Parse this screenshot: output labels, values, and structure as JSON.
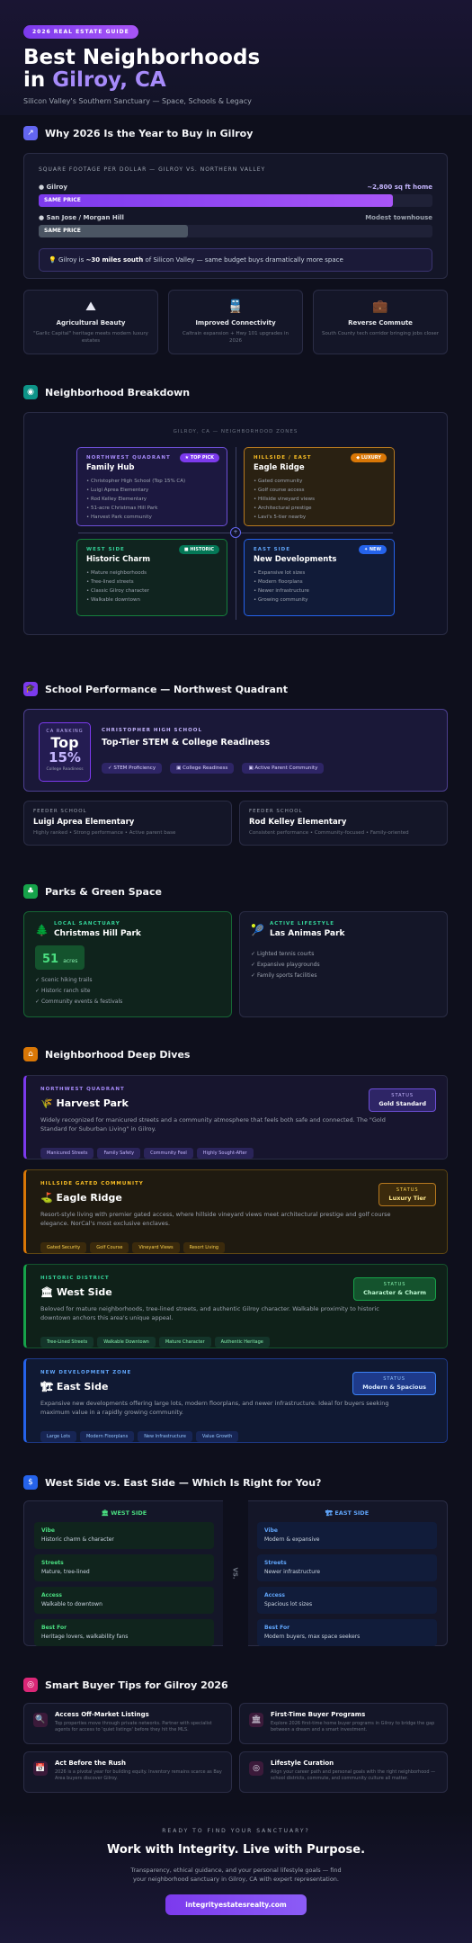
{
  "hero": {
    "badge": "2026 REAL ESTATE GUIDE",
    "title_line1": "Best Neighborhoods",
    "title_in": "in ",
    "title_accent": "Gilroy, CA",
    "subtitle": "Silicon Valley's Southern Sanctuary — Space, Schools & Legacy"
  },
  "why": {
    "title": "Why 2026 Is the Year to Buy in Gilroy",
    "chart_label": "SQUARE FOOTAGE PER DOLLAR — GILROY VS. NORTHERN VALLEY",
    "rows": [
      {
        "name": "Gilroy",
        "value": "~2,800 sq ft home",
        "bar_text": "SAME PRICE",
        "fill": 0.9
      },
      {
        "name": "San Jose / Morgan Hill",
        "value": "Modest townhouse",
        "bar_text": "SAME PRICE",
        "fill": 0.38
      }
    ],
    "callout_pre": "Gilroy is ",
    "callout_bold": "~30 miles south",
    "callout_post": " of Silicon Valley — same budget buys dramatically more space",
    "cards": [
      {
        "icon": "mountain-icon",
        "title": "Agricultural Beauty",
        "desc": "\"Garlic Capital\" heritage meets modern luxury estates"
      },
      {
        "icon": "train-icon",
        "title": "Improved Connectivity",
        "desc": "Caltrain expansion + Hwy 101 upgrades in 2026"
      },
      {
        "icon": "briefcase-icon",
        "title": "Reverse Commute",
        "desc": "South County tech corridor bringing jobs closer"
      }
    ]
  },
  "breakdown": {
    "title": "Neighborhood Breakdown",
    "map_label": "GILROY, CA — NEIGHBORHOOD ZONES",
    "quads": [
      {
        "tag": "NORTHWEST QUADRANT",
        "badge": "TOP PICK",
        "title": "Family Hub",
        "items": [
          "Christopher High School (Top 15% CA)",
          "Luigi Aprea Elementary",
          "Rod Kelley Elementary",
          "51-acre Christmas Hill Park",
          "Harvest Park community"
        ]
      },
      {
        "tag": "HILLSIDE / EAST",
        "badge": "LUXURY",
        "title": "Eagle Ridge",
        "items": [
          "Gated community",
          "Golf course access",
          "Hillside vineyard views",
          "Architectural prestige",
          "Lavi's 5-tier nearby"
        ]
      },
      {
        "tag": "WEST SIDE",
        "badge": "HISTORIC",
        "title": "Historic Charm",
        "items": [
          "Mature neighborhoods",
          "Tree-lined streets",
          "Classic Gilroy character",
          "Walkable downtown"
        ]
      },
      {
        "tag": "EAST SIDE",
        "badge": "NEW",
        "title": "New Developments",
        "items": [
          "Expansive lot sizes",
          "Modern floorplans",
          "Newer infrastructure",
          "Growing community"
        ]
      }
    ]
  },
  "school": {
    "title": "School Performance — Northwest Quadrant",
    "rank_label": "CA RANKING",
    "rank_top": "Top",
    "rank_pct": "15%",
    "rank_sub": "College Readiness",
    "school_name": "CHRISTOPHER HIGH SCHOOL",
    "headline": "Top-Tier STEM & College Readiness",
    "chips": [
      "STEM Proficiency",
      "College Readiness",
      "Active Parent Community"
    ],
    "feeders": [
      {
        "k": "FEEDER SCHOOL",
        "n": "Luigi Aprea Elementary",
        "s": "Highly ranked • Strong performance • Active parent base"
      },
      {
        "k": "FEEDER SCHOOL",
        "n": "Rod Kelley Elementary",
        "s": "Consistent performance • Community-focused • Family-oriented"
      }
    ]
  },
  "parks": {
    "title": "Parks & Green Space",
    "left": {
      "k": "LOCAL SANCTUARY",
      "n": "Christmas Hill Park",
      "acres": "51",
      "acres_unit": "acres",
      "items": [
        "Scenic hiking trails",
        "Historic ranch site",
        "Community events & festivals"
      ]
    },
    "right": {
      "k": "ACTIVE LIFESTYLE",
      "n": "Las Animas Park",
      "items": [
        "Lighted tennis courts",
        "Expansive playgrounds",
        "Family sports facilities"
      ]
    }
  },
  "dives": {
    "title": "Neighborhood Deep Dives",
    "items": [
      {
        "k": "NORTHWEST QUADRANT",
        "icon": "wheat-icon",
        "n": "Harvest Park",
        "desc": "Widely recognized for manicured streets and a community atmosphere that feels both safe and connected. The \"Gold Standard for Suburban Living\" in Gilroy.",
        "status1": "STATUS",
        "status2": "Gold Standard",
        "tags": [
          "Manicured Streets",
          "Family Safety",
          "Community Feel",
          "Highly Sought-After"
        ]
      },
      {
        "k": "HILLSIDE GATED COMMUNITY",
        "icon": "golf-icon",
        "n": "Eagle Ridge",
        "desc": "Resort-style living with premier gated access, where hillside vineyard views meet architectural prestige and golf course elegance. NorCal's most exclusive enclaves.",
        "status1": "STATUS",
        "status2": "Luxury Tier",
        "tags": [
          "Gated Security",
          "Golf Course",
          "Vineyard Views",
          "Resort Living"
        ]
      },
      {
        "k": "HISTORIC DISTRICT",
        "icon": "building-icon",
        "n": "West Side",
        "desc": "Beloved for mature neighborhoods, tree-lined streets, and authentic Gilroy character. Walkable proximity to historic downtown anchors this area's unique appeal.",
        "status1": "STATUS",
        "status2": "Character & Charm",
        "tags": [
          "Tree-Lined Streets",
          "Walkable Downtown",
          "Mature Character",
          "Authentic Heritage"
        ]
      },
      {
        "k": "NEW DEVELOPMENT ZONE",
        "icon": "crane-icon",
        "n": "East Side",
        "desc": "Expansive new developments offering large lots, modern floorplans, and newer infrastructure. Ideal for buyers seeking maximum value in a rapidly growing community.",
        "status1": "STATUS",
        "status2": "Modern & Spacious",
        "tags": [
          "Large Lots",
          "Modern Floorplans",
          "New Infrastructure",
          "Value Growth"
        ]
      }
    ]
  },
  "versus": {
    "title": "West Side vs. East Side — Which Is Right for You?",
    "vs": "VS.",
    "west_head": "WEST SIDE",
    "east_head": "EAST SIDE",
    "west": [
      {
        "k": "Vibe",
        "v": "Historic charm & character"
      },
      {
        "k": "Streets",
        "v": "Mature, tree-lined"
      },
      {
        "k": "Access",
        "v": "Walkable to downtown"
      },
      {
        "k": "Best For",
        "v": "Heritage lovers, walkability fans"
      }
    ],
    "east": [
      {
        "k": "Vibe",
        "v": "Modern & expansive"
      },
      {
        "k": "Streets",
        "v": "Newer infrastructure"
      },
      {
        "k": "Access",
        "v": "Spacious lot sizes"
      },
      {
        "k": "Best For",
        "v": "Modern buyers, max space seekers"
      }
    ]
  },
  "tips": {
    "title": "Smart Buyer Tips for Gilroy 2026",
    "items": [
      {
        "icon": "key-icon",
        "n": "Access Off-Market Listings",
        "d": "Top properties move through private networks. Partner with specialist agents for access to 'quiet listings' before they hit the MLS."
      },
      {
        "icon": "bank-icon",
        "n": "First-Time Buyer Programs",
        "d": "Explore 2026 first-time home buyer programs in Gilroy to bridge the gap between a dream and a smart investment."
      },
      {
        "icon": "calendar-icon",
        "n": "Act Before the Rush",
        "d": "2026 is a pivotal year for building equity. Inventory remains scarce as Bay Area buyers discover Gilroy."
      },
      {
        "icon": "target-icon",
        "n": "Lifestyle Curation",
        "d": "Align your career path and personal goals with the right neighborhood — school districts, commute, and community culture all matter."
      }
    ]
  },
  "cta": {
    "kicker": "READY TO FIND YOUR SANCTUARY?",
    "headline": "Work with Integrity. Live with Purpose.",
    "desc": "Transparency, ethical guidance, and your personal lifestyle goals — find your neighborhood sanctuary in Gilroy, CA with expert representation.",
    "button": "integrityestatesrealty.com"
  }
}
